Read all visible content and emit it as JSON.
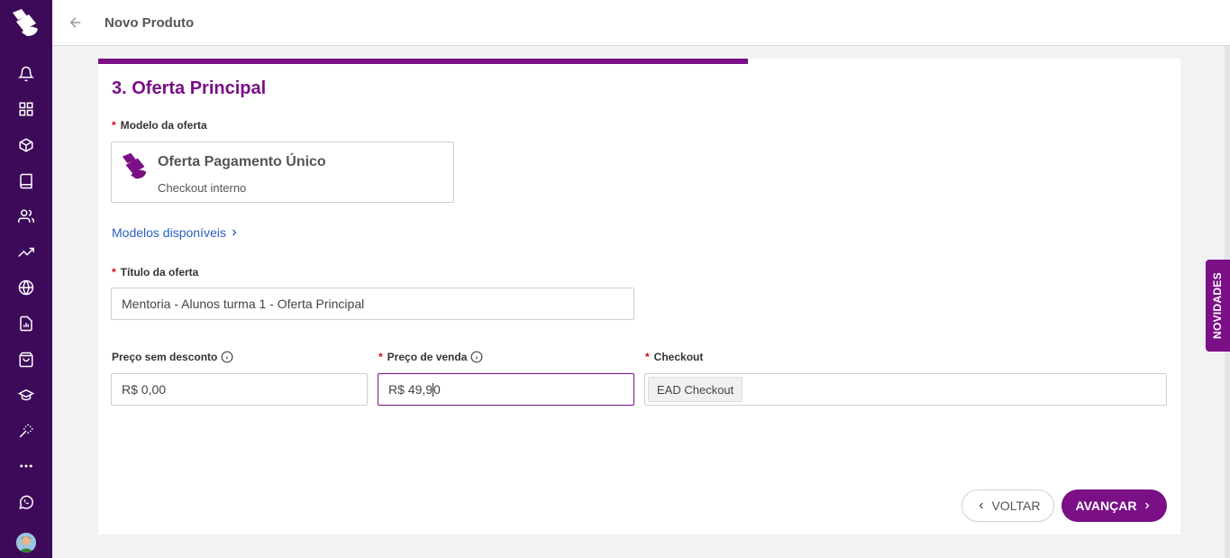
{
  "header": {
    "title": "Novo Produto"
  },
  "sidebar": {
    "items": [
      {
        "icon": "bell-icon"
      },
      {
        "icon": "grid-icon"
      },
      {
        "icon": "box-icon"
      },
      {
        "icon": "book-icon"
      },
      {
        "icon": "users-icon"
      },
      {
        "icon": "trending-up-icon"
      },
      {
        "icon": "globe-icon"
      },
      {
        "icon": "report-icon"
      },
      {
        "icon": "shopping-bag-icon"
      },
      {
        "icon": "graduation-cap-icon"
      },
      {
        "icon": "magic-wand-icon"
      },
      {
        "icon": "more-icon"
      },
      {
        "icon": "whatsapp-icon"
      }
    ]
  },
  "progress": {
    "fraction": 0.6
  },
  "step": {
    "title": "3. Oferta Principal"
  },
  "model": {
    "label": "Modelo da oferta",
    "name": "Oferta Pagamento Único",
    "subtitle": "Checkout interno",
    "link": "Modelos disponíveis"
  },
  "offer_title": {
    "label": "Título da oferta",
    "value": "Mentoria - Alunos turma 1 - Oferta Principal"
  },
  "price_no_discount": {
    "label": "Preço sem desconto",
    "value": "R$ 0,00"
  },
  "sale_price": {
    "label": "Preço de venda",
    "value_before_caret": "R$ 49,9",
    "value_after_caret": "0"
  },
  "checkout": {
    "label": "Checkout",
    "tag": "EAD Checkout"
  },
  "buttons": {
    "back": "VOLTAR",
    "next": "AVANÇAR"
  },
  "novidades": "NOVIDADES",
  "colors": {
    "brand": "#7a0f86",
    "sidebar": "#3d0a5a",
    "link": "#2b5fbf",
    "required": "#d0021b"
  }
}
